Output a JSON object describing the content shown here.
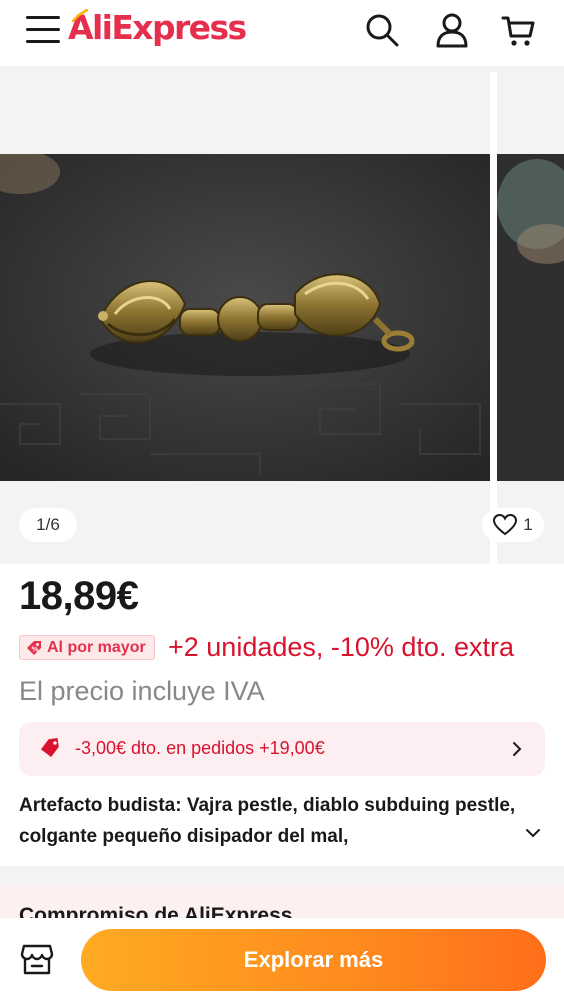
{
  "header": {
    "logo_text": "AliExpress",
    "icons": [
      "menu-icon",
      "search-icon",
      "user-icon",
      "cart-icon"
    ],
    "brand_color": "#e62e4d"
  },
  "gallery": {
    "counter": "1/6",
    "favorites_count": "1",
    "icons": [
      "heart-icon"
    ]
  },
  "price": {
    "amount": "18,89€",
    "wholesale_badge": "Al por mayor",
    "wholesale_offer": "+2 unidades, -10% dto. extra",
    "vat_note": "El precio incluye IVA"
  },
  "coupon": {
    "text": "-3,00€ dto. en pedidos +19,00€",
    "icons": [
      "tag-icon",
      "chevron-right-icon"
    ]
  },
  "product": {
    "title": "Artefacto budista: Vajra pestle, diablo subduing pestle, colgante pequeño disipador del mal,"
  },
  "commitment": {
    "heading": "Compromiso de AliExpress"
  },
  "bottom_bar": {
    "explore_label": "Explorar más",
    "icons": [
      "store-icon"
    ]
  },
  "colors": {
    "accent_red": "#d9122e",
    "button_orange_start": "#ffaa22",
    "button_orange_end": "#ff6e1a"
  }
}
